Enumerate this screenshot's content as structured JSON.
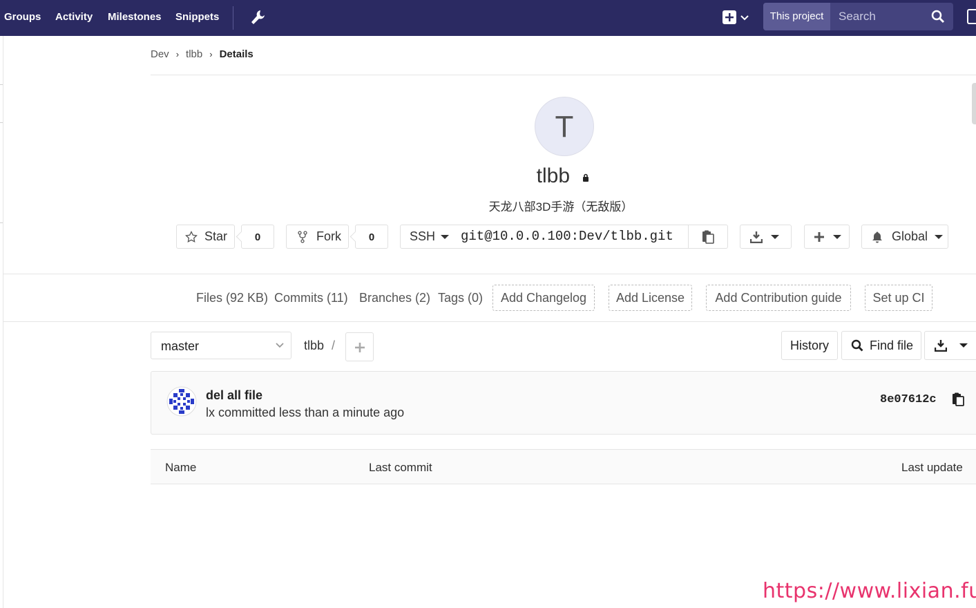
{
  "navbar": {
    "links": [
      "Groups",
      "Activity",
      "Milestones",
      "Snippets"
    ],
    "icons": [
      "wrench-icon",
      "plus-square-icon",
      "chevron-down-icon",
      "search-icon"
    ],
    "search": {
      "scope": "This project",
      "placeholder": "Search"
    },
    "colors": {
      "background": "#2b2a62",
      "scope_bg": "#5c5b95"
    }
  },
  "breadcrumb": {
    "group": "Dev",
    "project": "tlbb",
    "current": "Details"
  },
  "project": {
    "avatar_letter": "T",
    "name": "tlbb",
    "visibility_icon": "lock-icon",
    "description": "天龙八部3D手游（无敌版）"
  },
  "actions": {
    "star_label": "Star",
    "star_count": "0",
    "fork_label": "Fork",
    "fork_count": "0",
    "protocol": "SSH",
    "clone_url": "git@10.0.0.100:Dev/tlbb.git",
    "notification_label": "Global"
  },
  "stats": {
    "files": "Files (92 KB)",
    "commits": "Commits (11)",
    "branches": "Branches (2)",
    "tags": "Tags (0)",
    "add_changelog": "Add Changelog",
    "add_license": "Add License",
    "add_contribution": "Add Contribution guide",
    "setup_ci": "Set up CI"
  },
  "tree": {
    "branch": "master",
    "path": "tlbb",
    "path_sep": "/",
    "history_label": "History",
    "find_file_label": "Find file"
  },
  "commit": {
    "title": "del all file",
    "meta": "lx committed less than a minute ago",
    "sha": "8e07612c"
  },
  "table": {
    "headers": [
      "Name",
      "Last commit",
      "Last update"
    ]
  },
  "watermark": "https://www.lixian.fun"
}
